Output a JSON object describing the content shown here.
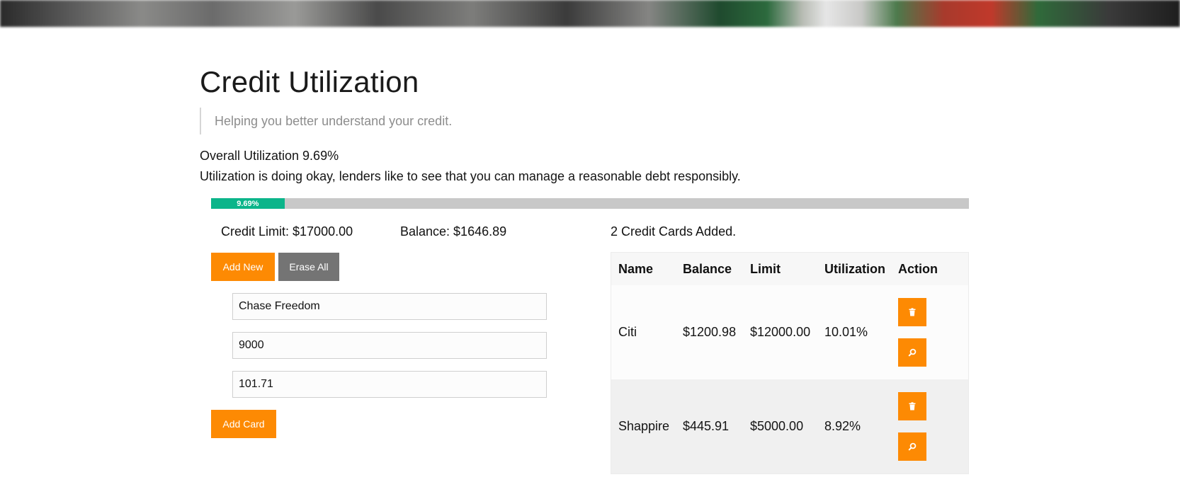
{
  "header": {
    "title": "Credit Utilization",
    "tagline": "Helping you better understand your credit."
  },
  "summary": {
    "overall_text": "Overall Utilization 9.69%",
    "message": "Utilization is doing okay, lenders like to see that you can manage a reasonable debt responsibly.",
    "progress_label": "9.69%",
    "progress_fraction": 0.0969,
    "progress_color": "#0bb58a",
    "credit_limit_text": "Credit Limit: $17000.00",
    "balance_text": "Balance: $1646.89",
    "cards_added_text": "2 Credit Cards Added."
  },
  "buttons": {
    "add_new": "Add New",
    "erase_all": "Erase All",
    "add_card": "Add Card"
  },
  "form": {
    "name_value": "Chase Freedom",
    "limit_value": "9000",
    "balance_value": "101.71"
  },
  "table": {
    "headers": [
      "Name",
      "Balance",
      "Limit",
      "Utilization",
      "Action"
    ],
    "rows": [
      {
        "name": "Citi",
        "balance": "$1200.98",
        "limit": "$12000.00",
        "utilization": "10.01%"
      },
      {
        "name": "Shappire",
        "balance": "$445.91",
        "limit": "$5000.00",
        "utilization": "8.92%"
      }
    ],
    "action_icons": [
      "trash-icon",
      "search-icon"
    ]
  },
  "colors": {
    "accent": "#fd8a03",
    "secondary_button": "#747474",
    "progress_track": "#c8c8c8"
  }
}
